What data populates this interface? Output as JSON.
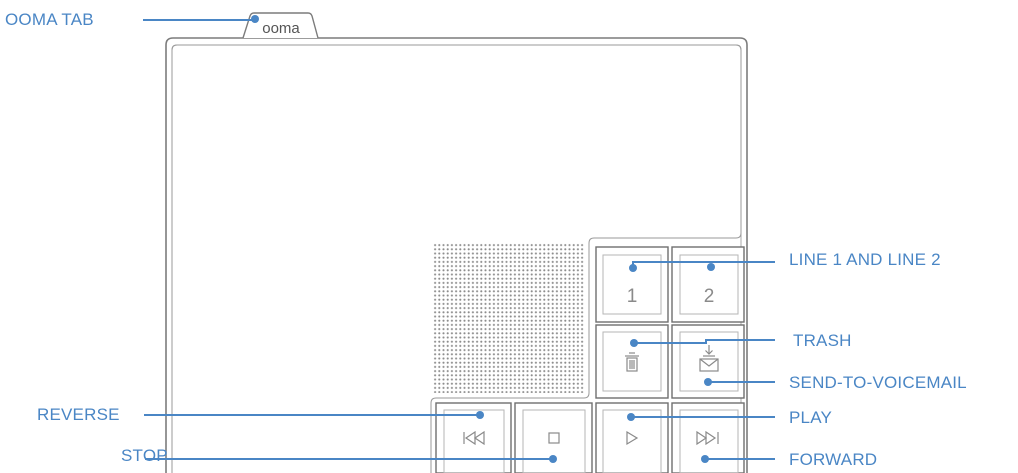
{
  "device": {
    "brand_tab": "ooma",
    "line1_glyph": "1",
    "line2_glyph": "2"
  },
  "callouts": {
    "ooma_tab": "OOMA TAB",
    "lines": "LINE 1 AND LINE 2",
    "trash": "TRASH",
    "send_to_voicemail": "SEND-TO-VOICEMAIL",
    "play": "PLAY",
    "forward": "FORWARD",
    "reverse": "REVERSE",
    "stop": "STOP"
  },
  "colors": {
    "callout_blue": "#4a86c5",
    "device_outline": "#7c7c7c",
    "icon_gray": "#9a9a9a"
  },
  "icons": {
    "trash": "trash-icon",
    "voicemail": "envelope-down-arrow-icon",
    "reverse": "rewind-icon",
    "stop": "stop-icon",
    "play": "play-icon",
    "forward": "fast-forward-icon"
  }
}
